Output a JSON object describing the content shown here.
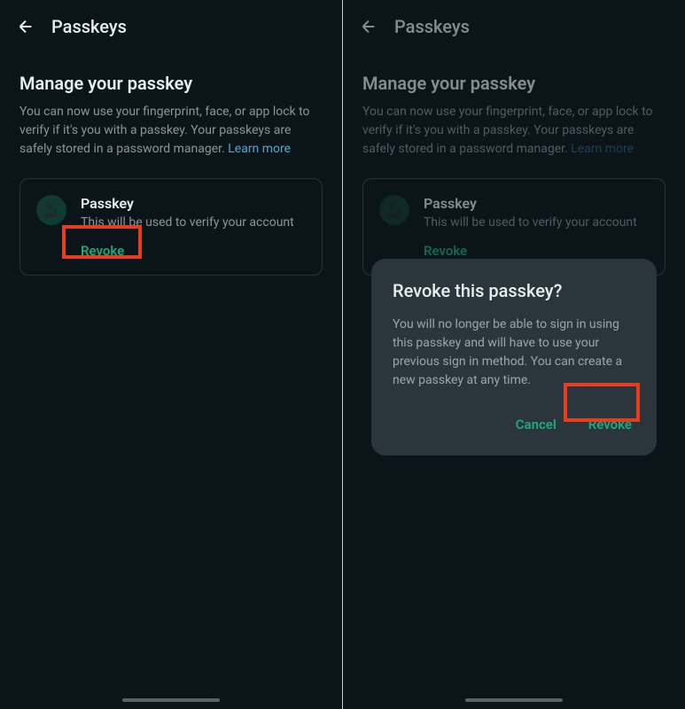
{
  "left": {
    "header": {
      "title": "Passkeys"
    },
    "section": {
      "title": "Manage your passkey",
      "desc": "You can now use your fingerprint, face, or app lock to verify if it's you with a passkey. Your passkeys are safely stored in a password manager. ",
      "learn_more": "Learn more"
    },
    "card": {
      "title": "Passkey",
      "sub": "This will be used to verify your account",
      "revoke": "Revoke"
    }
  },
  "right": {
    "header": {
      "title": "Passkeys"
    },
    "section": {
      "title": "Manage your passkey",
      "desc": "You can now use your fingerprint, face, or app lock to verify if it's you with a passkey. Your passkeys are safely stored in a password manager. ",
      "learn_more": "Learn more"
    },
    "card": {
      "title": "Passkey",
      "sub": "This will be used to verify your account",
      "revoke": "Revoke"
    },
    "dialog": {
      "title": "Revoke this passkey?",
      "body": "You will no longer be able to sign in using this passkey and will have to use your previous sign in method. You can create a new passkey at any time.",
      "cancel": "Cancel",
      "confirm": "Revoke"
    }
  }
}
